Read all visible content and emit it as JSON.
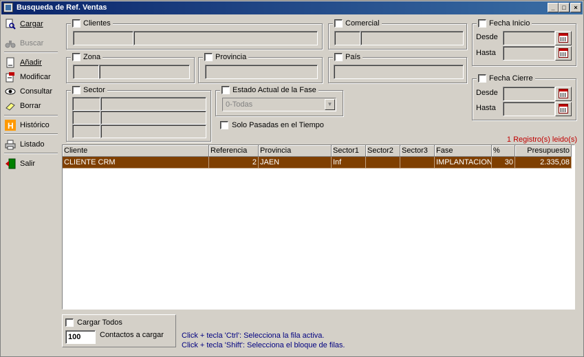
{
  "window": {
    "title": "Busqueda de Ref. Ventas",
    "buttons": [
      "_",
      "□",
      "×"
    ]
  },
  "sidebar": {
    "items": [
      {
        "label": "Cargar",
        "icon": "search-doc-icon",
        "enabled": true
      },
      {
        "label": "Buscar",
        "icon": "binoculars-icon",
        "enabled": false
      },
      {
        "label": "Añadir",
        "icon": "new-doc-icon",
        "enabled": true
      },
      {
        "label": "Modificar",
        "icon": "edit-doc-icon",
        "enabled": true
      },
      {
        "label": "Consultar",
        "icon": "eye-icon",
        "enabled": true
      },
      {
        "label": "Borrar",
        "icon": "eraser-icon",
        "enabled": true
      },
      {
        "label": "Histórico",
        "icon": "history-h-icon",
        "enabled": true
      },
      {
        "label": "Listado",
        "icon": "printer-icon",
        "enabled": true
      },
      {
        "label": "Salir",
        "icon": "exit-icon",
        "enabled": true
      }
    ]
  },
  "filters": {
    "clientes": "Clientes",
    "comercial": "Comercial",
    "zona": "Zona",
    "provincia": "Provincia",
    "pais": "País",
    "sector": "Sector",
    "estado": "Estado Actual de la Fase",
    "estado_value": "0-Todas",
    "solo_pasadas": "Solo Pasadas en el Tiempo",
    "fecha_inicio": "Fecha Inicio",
    "fecha_cierre": "Fecha Cierre",
    "desde": "Desde",
    "hasta": "Hasta"
  },
  "records_text": "1 Registro(s) leido(s)",
  "grid": {
    "columns": [
      "Cliente",
      "Referencia",
      "Provincia",
      "Sector1",
      "Sector2",
      "Sector3",
      "Fase",
      "%",
      "Presupuesto"
    ],
    "rows": [
      [
        "CLIENTE CRM",
        "2",
        "JAEN",
        "Inf",
        "",
        "",
        "IMPLANTACION",
        "30",
        "2.335,08"
      ]
    ]
  },
  "bottom": {
    "cargar_todos": "Cargar Todos",
    "quantity": "100",
    "contactos_label": "Contactos a cargar",
    "hint1": "Click + tecla 'Ctrl': Selecciona la fila activa.",
    "hint2": "Click + tecla 'Shift': Selecciona el bloque de filas."
  },
  "colors": {
    "selected_row": "#7f3f00",
    "records_text": "#c00000"
  }
}
